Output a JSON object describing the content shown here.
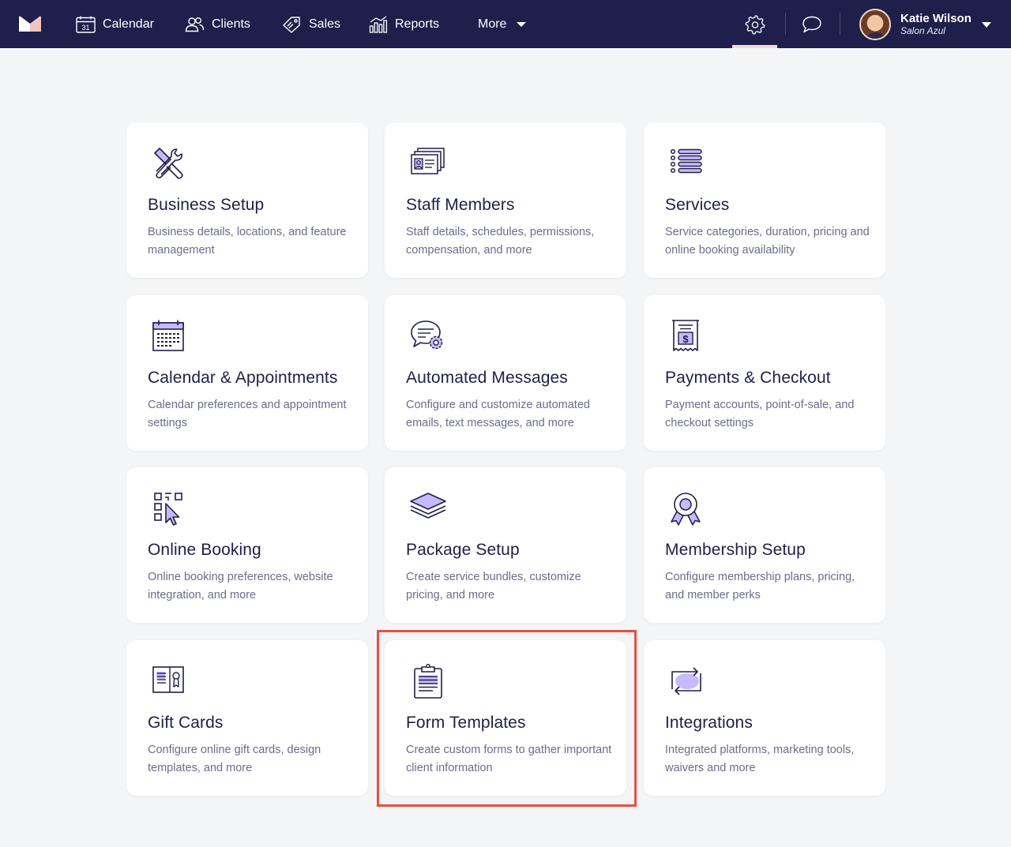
{
  "nav": {
    "calendar": "Calendar",
    "clients": "Clients",
    "sales": "Sales",
    "reports": "Reports",
    "more": "More",
    "calendar_day": "31"
  },
  "user": {
    "name": "Katie Wilson",
    "business": "Salon Azul"
  },
  "colors": {
    "nav_bg": "#1e1f4b",
    "accent": "#b9a6ff",
    "highlight": "#e8503f",
    "active_tab": "#f7d8cf"
  },
  "cards": [
    {
      "title": "Business Setup",
      "desc": "Business details, locations, and feature management",
      "icon": "tools-icon"
    },
    {
      "title": "Staff Members",
      "desc": "Staff details, schedules, permissions, compensation, and more",
      "icon": "staff-cards-icon"
    },
    {
      "title": "Services",
      "desc": "Service categories, duration, pricing and online booking availability",
      "icon": "list-icon"
    },
    {
      "title": "Calendar & Appointments",
      "desc": "Calendar preferences and appointment settings",
      "icon": "calendar-grid-icon"
    },
    {
      "title": "Automated Messages",
      "desc": "Configure and customize automated emails, text messages, and more",
      "icon": "message-gear-icon"
    },
    {
      "title": "Payments & Checkout",
      "desc": "Payment accounts, point-of-sale, and checkout settings",
      "icon": "receipt-icon"
    },
    {
      "title": "Online Booking",
      "desc": "Online booking preferences, website integration, and more",
      "icon": "qr-cursor-icon"
    },
    {
      "title": "Package Setup",
      "desc": "Create service bundles, customize pricing, and more",
      "icon": "layers-icon"
    },
    {
      "title": "Membership Setup",
      "desc": "Configure membership plans, pricing, and member perks",
      "icon": "award-icon"
    },
    {
      "title": "Gift Cards",
      "desc": "Configure online gift cards, design templates, and more",
      "icon": "gift-card-icon"
    },
    {
      "title": "Form Templates",
      "desc": "Create custom forms to gather important client information",
      "icon": "clipboard-icon"
    },
    {
      "title": "Integrations",
      "desc": "Integrated platforms, marketing tools, waivers and more",
      "icon": "sync-icon"
    }
  ]
}
